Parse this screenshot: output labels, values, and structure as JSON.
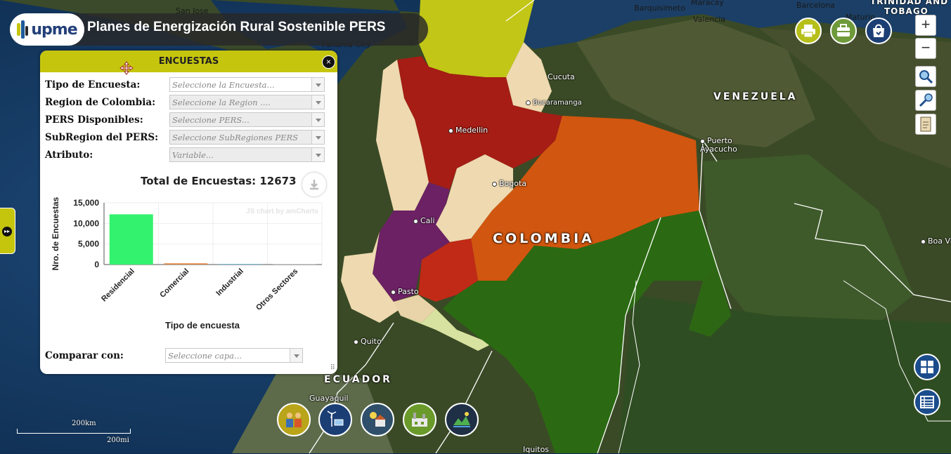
{
  "header": {
    "logo_text": "upme",
    "title": "Planes de Energización Rural Sostenible PERS"
  },
  "map": {
    "countries": [
      "VENEZUELA",
      "COLOMBIA",
      "ECUADOR"
    ],
    "cities": [
      "Medellin",
      "Bucaramanga",
      "Cucuta",
      "Bogota",
      "Cali",
      "Pasto",
      "Quito",
      "Guayaquil",
      "Iquitos",
      "Puerto Ayacucho",
      "Boa Vis",
      "Barquisimeto",
      "Maracay",
      "Valencia",
      "Barcelona",
      "Maturin",
      "San Jose",
      "Panama City"
    ],
    "island_label_1": "TRINIDAD AND",
    "island_label_2": "TOBAGO",
    "scale_km": "200km",
    "scale_mi": "200mi"
  },
  "toolbar": {
    "zoom_in": "+",
    "zoom_out": "−"
  },
  "panel": {
    "title": "ENCUESTAS",
    "close": "×",
    "fields": [
      {
        "label": "Tipo de Encuesta:",
        "placeholder": "Seleccione la Encuesta...",
        "enabled": true
      },
      {
        "label": "Region de Colombia:",
        "placeholder": "Seleccione la Region ....",
        "enabled": false
      },
      {
        "label": "PERS Disponibles:",
        "placeholder": "Seleccione PERS...",
        "enabled": false
      },
      {
        "label": "SubRegion del PERS:",
        "placeholder": "Seleccione SubRegiones PERS",
        "enabled": false
      },
      {
        "label": "Atributo:",
        "placeholder": "Variable...",
        "enabled": false
      }
    ],
    "total_label": "Total de Encuestas: 12673",
    "watermark": "JS chart by amCharts",
    "compare_label": "Comparar con:",
    "compare_placeholder": "Seleccione capa..."
  },
  "chart_data": {
    "type": "bar",
    "categories": [
      "Residencial",
      "Comercial",
      "Industrial",
      "Otros Sectores"
    ],
    "values": [
      12200,
      300,
      150,
      20
    ],
    "colors": [
      "#33f26e",
      "#e0884a",
      "#7fc4d6",
      "#cccccc"
    ],
    "xlabel": "Tipo de encuesta",
    "ylabel": "Nro. de Encuestas",
    "yticks": [
      "0",
      "5,000",
      "10,000",
      "15,000"
    ],
    "ylim": [
      0,
      15000
    ],
    "grid": true
  }
}
